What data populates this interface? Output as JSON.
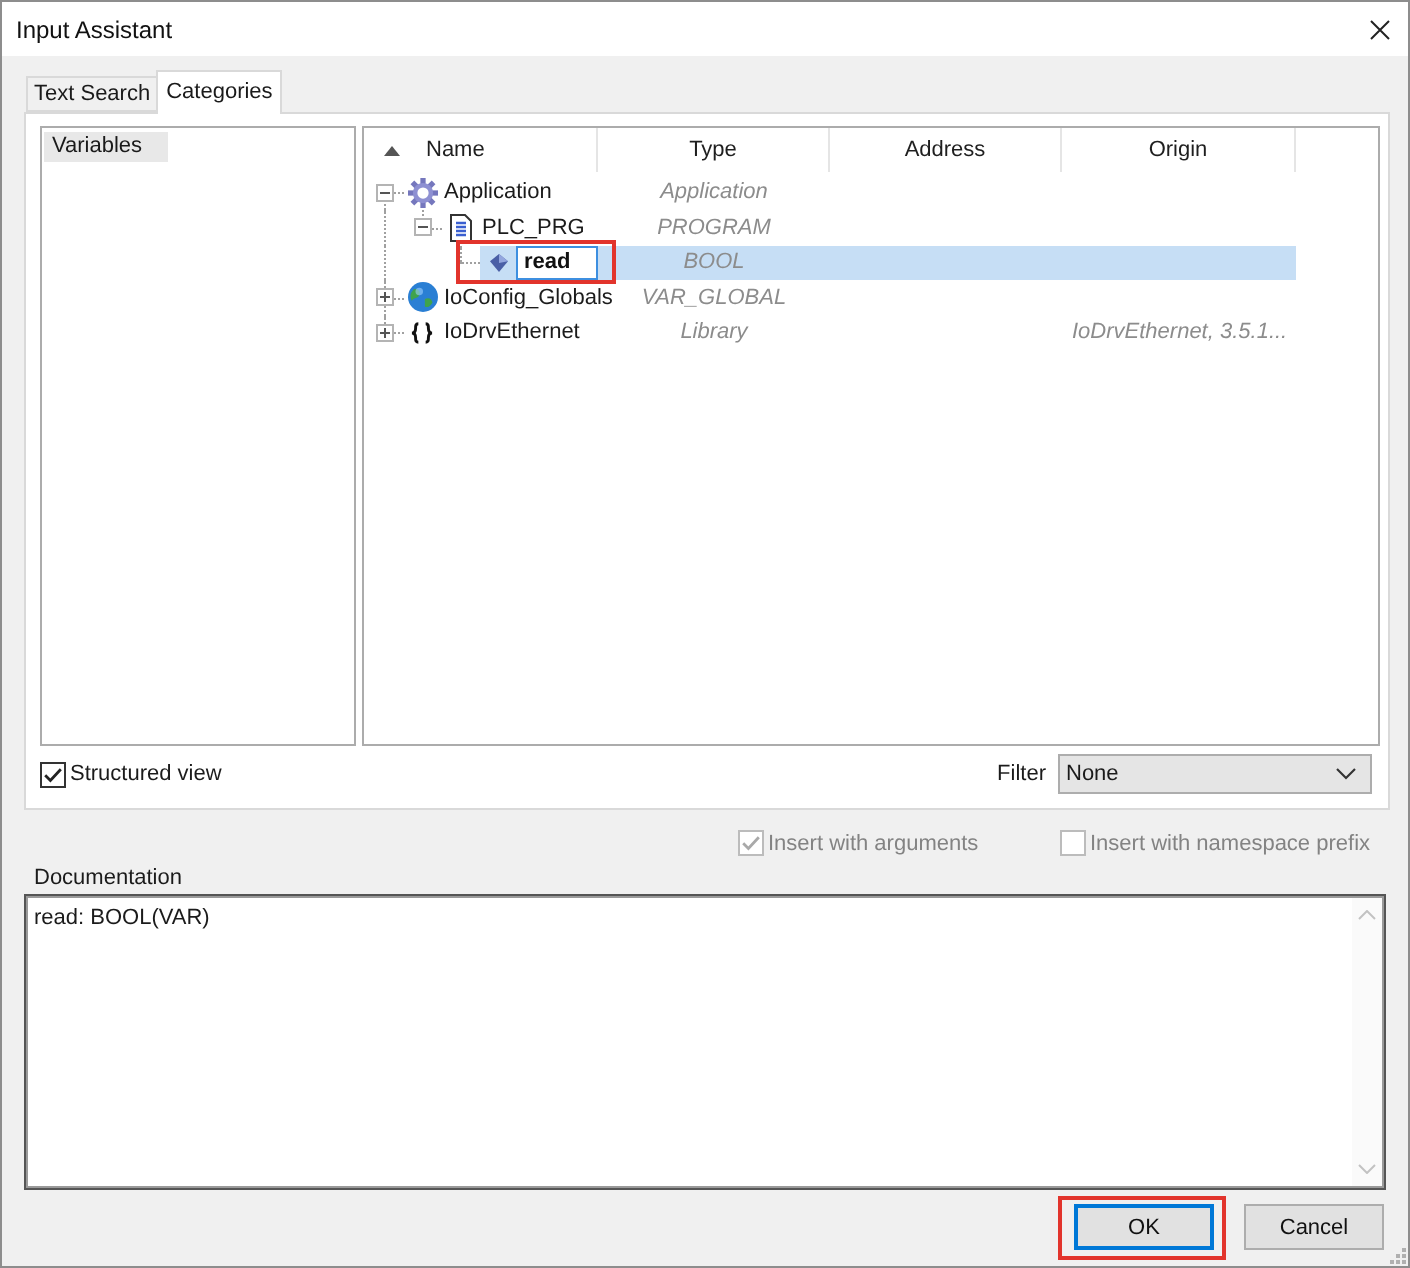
{
  "window": {
    "title": "Input Assistant"
  },
  "tabs": [
    {
      "label": "Text Search",
      "selected": false
    },
    {
      "label": "Categories",
      "selected": true
    }
  ],
  "categories": [
    {
      "label": "Variables",
      "selected": true
    }
  ],
  "tree": {
    "columns": [
      {
        "label": "Name",
        "sorted": true
      },
      {
        "label": "Type",
        "sorted": false
      },
      {
        "label": "Address",
        "sorted": false
      },
      {
        "label": "Origin",
        "sorted": false
      }
    ],
    "rows": [
      {
        "kind": "application",
        "name": "Application",
        "type": "Application",
        "expanded": true,
        "selected": false,
        "children": [
          {
            "kind": "program",
            "name": "PLC_PRG",
            "type": "PROGRAM",
            "expanded": true,
            "selected": false,
            "children": [
              {
                "kind": "variable",
                "name": "read",
                "type": "BOOL",
                "selected": true,
                "editing": true,
                "annotated": true
              }
            ]
          }
        ]
      },
      {
        "kind": "globals",
        "name": "IoConfig_Globals",
        "type": "VAR_GLOBAL",
        "expanded": false,
        "selected": false
      },
      {
        "kind": "library",
        "name": "IoDrvEthernet",
        "type": "Library",
        "origin": "IoDrvEthernet, 3.5.1...",
        "expanded": false,
        "selected": false
      }
    ]
  },
  "structured_view": {
    "label": "Structured view",
    "checked": true
  },
  "filter": {
    "label": "Filter",
    "value": "None"
  },
  "insert_options": [
    {
      "label": "Insert with arguments",
      "checked": true,
      "disabled": true
    },
    {
      "label": "Insert with namespace prefix",
      "checked": false,
      "disabled": true
    }
  ],
  "documentation": {
    "label": "Documentation",
    "text": "read: BOOL(VAR)"
  },
  "buttons": [
    {
      "label": "OK",
      "default": true,
      "annotated": true
    },
    {
      "label": "Cancel",
      "default": false,
      "annotated": false
    }
  ]
}
